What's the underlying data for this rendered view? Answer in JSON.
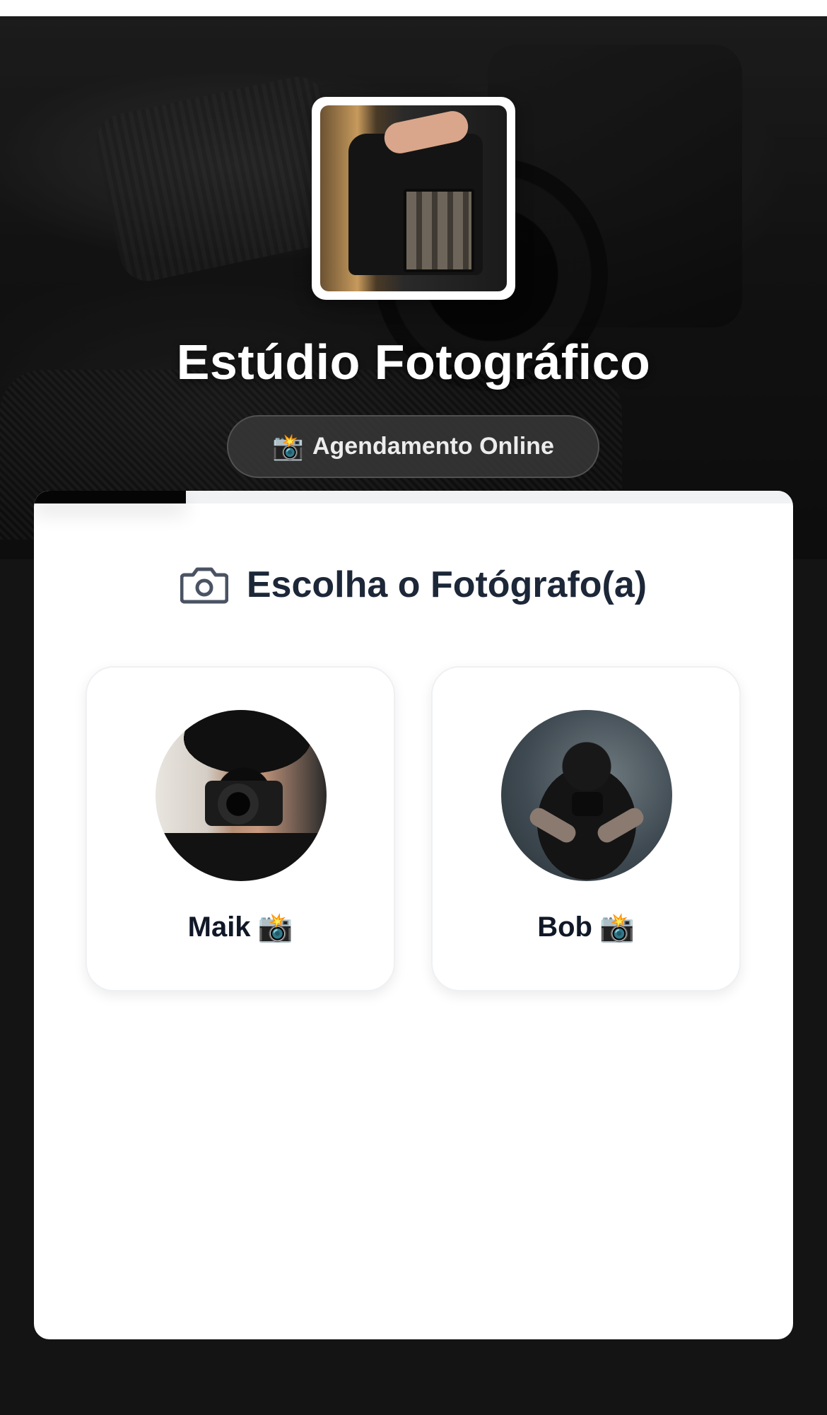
{
  "studio": {
    "title": "Estúdio Fotográfico",
    "badge_emoji": "📸",
    "badge_label": "Agendamento Online"
  },
  "progress": {
    "fraction": 0.2
  },
  "section": {
    "icon": "camera-icon",
    "title": "Escolha o Fotógrafo(a)"
  },
  "photographers": [
    {
      "name": "Maik",
      "emoji": "📸"
    },
    {
      "name": "Bob",
      "emoji": "📸"
    }
  ],
  "colors": {
    "page_background": "#141414",
    "card_background": "#ffffff",
    "title_text": "#1c2738",
    "name_text": "#101828",
    "progress_fill": "#050505",
    "progress_track": "#f1f2f4"
  }
}
